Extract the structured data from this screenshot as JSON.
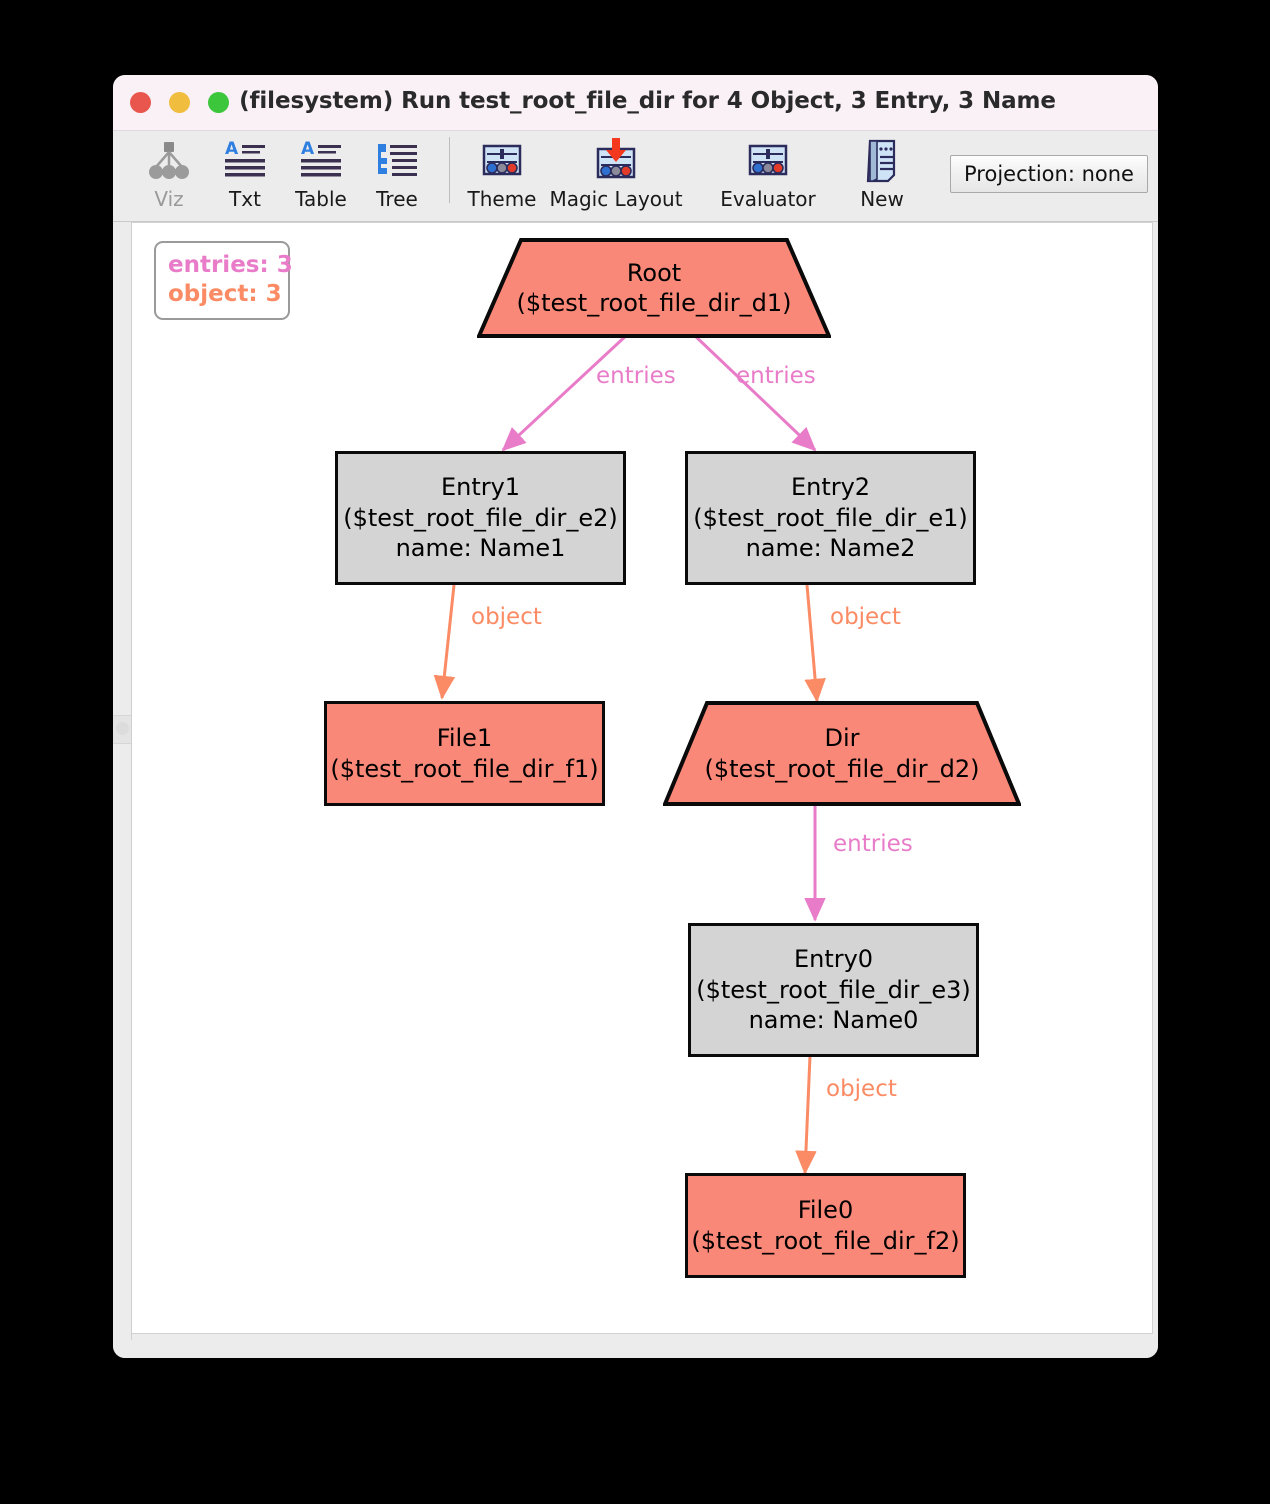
{
  "window": {
    "title": "(filesystem) Run test_root_file_dir for 4 Object, 3 Entry, 3 Name",
    "traffic_lights": {
      "close": "close-button",
      "minimize": "minimize-button",
      "zoom": "zoom-button"
    }
  },
  "toolbar": {
    "items": [
      {
        "label": "Viz",
        "icon": "graph-nodes-icon",
        "disabled": true
      },
      {
        "label": "Txt",
        "icon": "text-lines-icon",
        "disabled": false
      },
      {
        "label": "Table",
        "icon": "text-lines-icon",
        "disabled": false
      },
      {
        "label": "Tree",
        "icon": "tree-list-icon",
        "disabled": false
      },
      {
        "label": "Theme",
        "icon": "theme-panel-icon",
        "disabled": false
      },
      {
        "label": "Magic Layout",
        "icon": "magic-layout-icon",
        "disabled": false
      },
      {
        "label": "Evaluator",
        "icon": "evaluator-icon",
        "disabled": false
      },
      {
        "label": "New",
        "icon": "new-scroll-icon",
        "disabled": false
      }
    ],
    "projection_button": "Projection: none"
  },
  "colors": {
    "entries_edge": "#e87cc8",
    "object_edge": "#fb8b64",
    "node_salmon": "#fa8878",
    "node_gray": "#d4d4d4",
    "node_border": "#0a0a0a"
  },
  "graph": {
    "legend": [
      {
        "text": "entries: 3",
        "color": "#e87cc8"
      },
      {
        "text": "object: 3",
        "color": "#fb8b64"
      }
    ],
    "nodes": [
      {
        "id": "root",
        "shape": "trapezoid",
        "fill": "salmon",
        "lines": [
          "Root",
          "($test_root_file_dir_d1)"
        ]
      },
      {
        "id": "entry1",
        "shape": "rect",
        "fill": "gray",
        "lines": [
          "Entry1",
          "($test_root_file_dir_e2)",
          "name: Name1"
        ]
      },
      {
        "id": "entry2",
        "shape": "rect",
        "fill": "gray",
        "lines": [
          "Entry2",
          "($test_root_file_dir_e1)",
          "name: Name2"
        ]
      },
      {
        "id": "file1",
        "shape": "rect",
        "fill": "salmon",
        "lines": [
          "File1",
          "($test_root_file_dir_f1)"
        ]
      },
      {
        "id": "dir",
        "shape": "trapezoid",
        "fill": "salmon",
        "lines": [
          "Dir",
          "($test_root_file_dir_d2)"
        ]
      },
      {
        "id": "entry0",
        "shape": "rect",
        "fill": "gray",
        "lines": [
          "Entry0",
          "($test_root_file_dir_e3)",
          "name: Name0"
        ]
      },
      {
        "id": "file0",
        "shape": "rect",
        "fill": "salmon",
        "lines": [
          "File0",
          "($test_root_file_dir_f2)"
        ]
      }
    ],
    "edges": [
      {
        "from": "root",
        "to": "entry1",
        "label": "entries",
        "color": "#e87cc8"
      },
      {
        "from": "root",
        "to": "entry2",
        "label": "entries",
        "color": "#e87cc8"
      },
      {
        "from": "entry1",
        "to": "file1",
        "label": "object",
        "color": "#fb8b64"
      },
      {
        "from": "entry2",
        "to": "dir",
        "label": "object",
        "color": "#fb8b64"
      },
      {
        "from": "dir",
        "to": "entry0",
        "label": "entries",
        "color": "#e87cc8"
      },
      {
        "from": "entry0",
        "to": "file0",
        "label": "object",
        "color": "#fb8b64"
      }
    ]
  }
}
